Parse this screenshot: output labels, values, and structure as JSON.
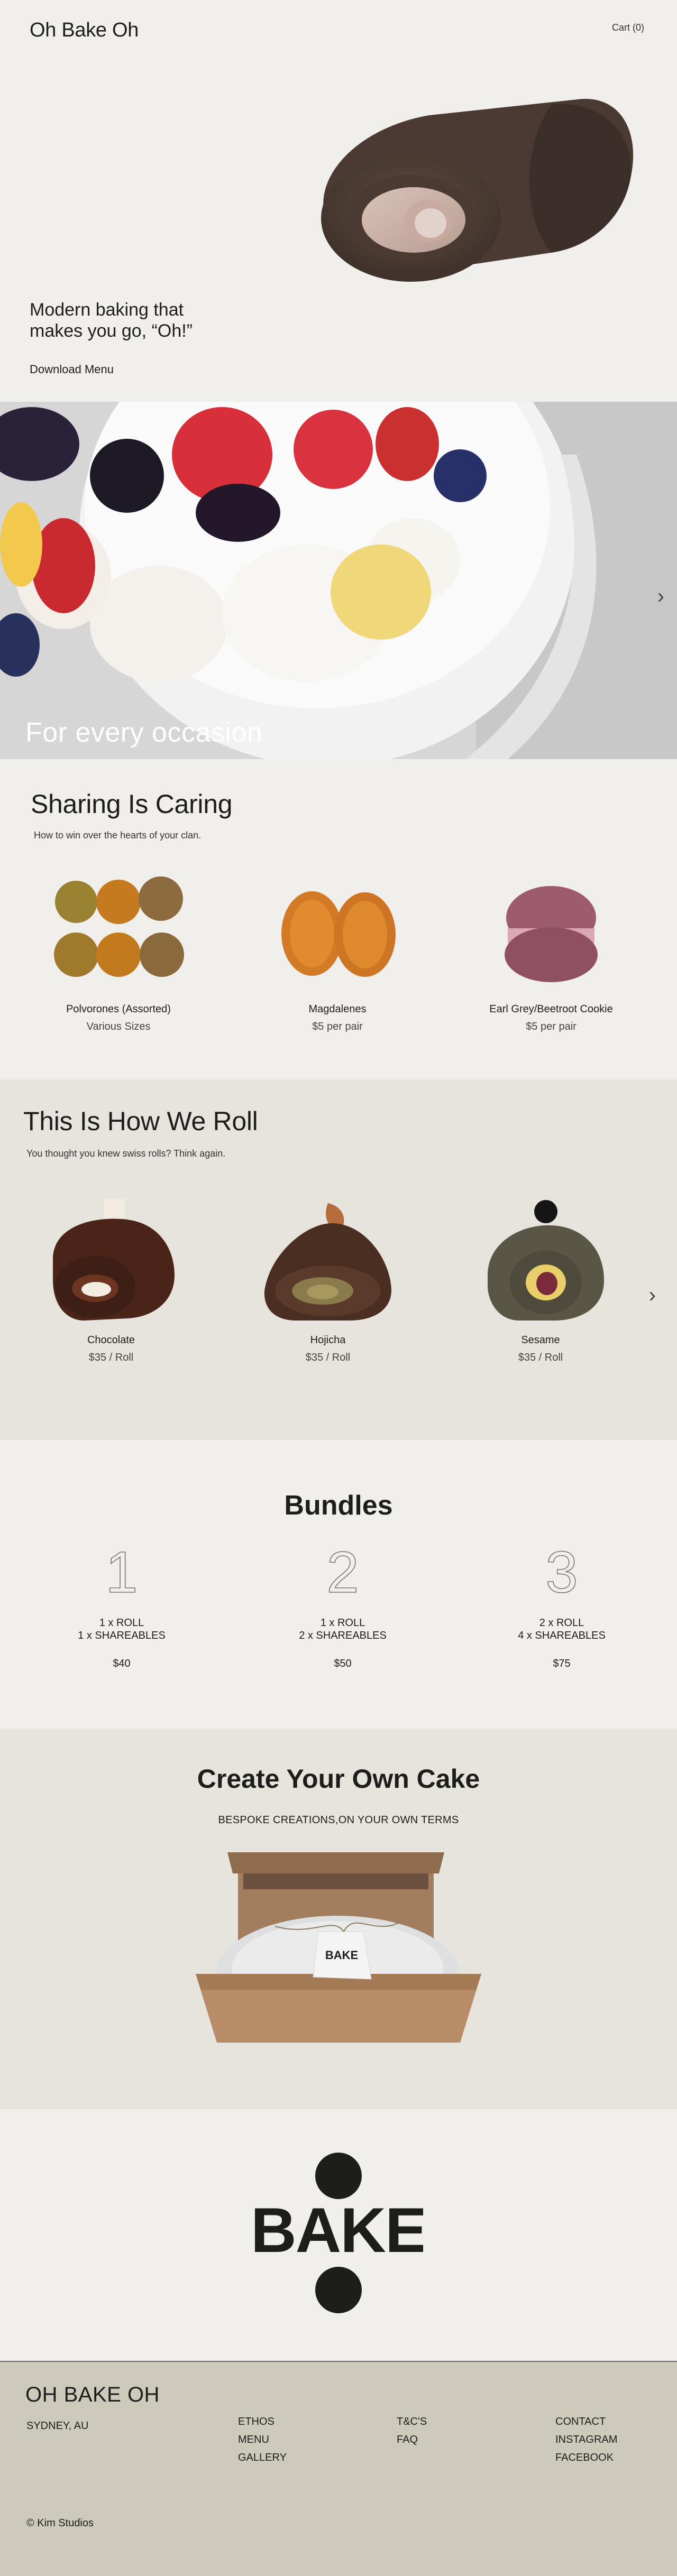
{
  "header": {
    "logo": "Oh Bake Oh",
    "cart_label": "Cart (0)"
  },
  "hero": {
    "tagline": "Modern baking that makes you go, “Oh!”",
    "download_label": "Download Menu"
  },
  "occasion": {
    "title": "For every occasion",
    "next_icon": "chevron-right-icon"
  },
  "sharing": {
    "title": "Sharing Is Caring",
    "subtitle": "How to win over the hearts of your clan.",
    "products": [
      {
        "name": "Polvorones (Assorted)",
        "price": "Various Sizes"
      },
      {
        "name": "Magdalenes",
        "price": "$5 per pair"
      },
      {
        "name": "Earl Grey/Beetroot Cookie",
        "price": "$5 per pair"
      }
    ]
  },
  "rolls": {
    "title": "This Is How We Roll",
    "subtitle": "You thought you knew swiss rolls? Think again.",
    "items": [
      {
        "name": "Chocolate",
        "price": "$35 / Roll"
      },
      {
        "name": "Hojicha",
        "price": "$35 / Roll"
      },
      {
        "name": "Sesame",
        "price": "$35 / Roll"
      }
    ],
    "next_icon": "chevron-right-icon"
  },
  "bundles": {
    "title": "Bundles",
    "items": [
      {
        "number": "1",
        "line1": "1 x ROLL",
        "line2": "1 x SHAREABLES",
        "price": "$40"
      },
      {
        "number": "2",
        "line1": "1 x ROLL",
        "line2": "2 x SHAREABLES",
        "price": "$50"
      },
      {
        "number": "3",
        "line1": "2 x ROLL",
        "line2": "4 x SHAREABLES",
        "price": "$75"
      }
    ]
  },
  "create": {
    "title": "Create Your Own Cake",
    "subtitle": "BESPOKE CREATIONS,ON YOUR OWN TERMS",
    "tag_text": "BAKE"
  },
  "bake_logo": {
    "text": "BAKE"
  },
  "footer": {
    "brand": "OH BAKE OH",
    "city": "SYDNEY, AU",
    "col1": [
      "ETHOS",
      "MENU",
      "GALLERY"
    ],
    "col2": [
      "T&C'S",
      "FAQ"
    ],
    "col3": [
      "CONTACT",
      "INSTAGRAM",
      "FACEBOOK"
    ],
    "copyright": "© Kim Studios"
  },
  "colors": {
    "page_bg": "#f0efeb",
    "alt_bg": "#e6e4dd",
    "footer_bg": "#cdc9bb",
    "text": "#1d1d1b"
  }
}
